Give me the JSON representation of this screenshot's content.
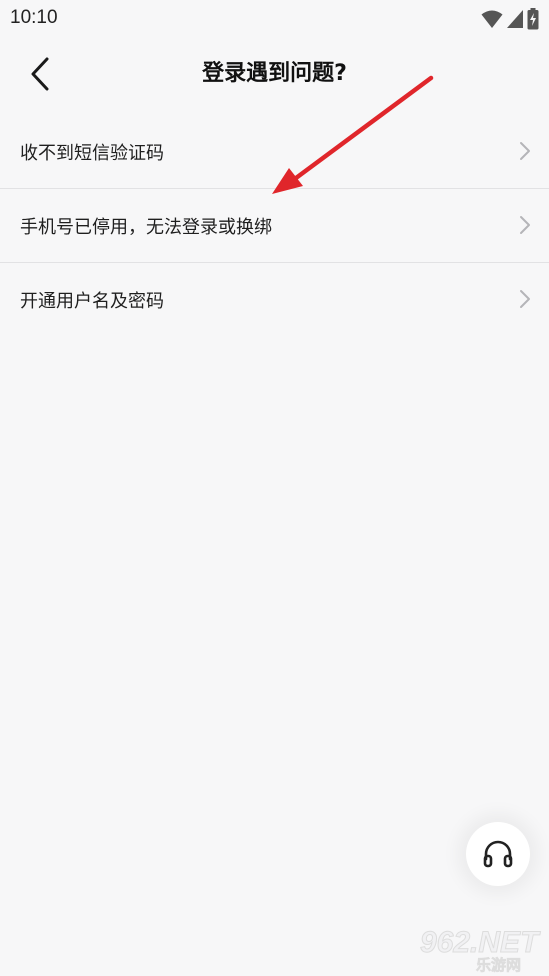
{
  "status_bar": {
    "time": "10:10",
    "icons": [
      "wifi-icon",
      "signal-icon",
      "battery-charging-icon"
    ]
  },
  "nav": {
    "back_icon": "chevron-left-icon",
    "title": "登录遇到问题?"
  },
  "menu": {
    "items": [
      {
        "label": "收不到短信验证码",
        "icon": "chevron-right-icon"
      },
      {
        "label": "手机号已停用，无法登录或换绑",
        "icon": "chevron-right-icon"
      },
      {
        "label": "开通用户名及密码",
        "icon": "chevron-right-icon"
      }
    ]
  },
  "support": {
    "icon": "headset-icon"
  },
  "annotation": {
    "arrow_color": "#e0262b"
  },
  "watermark": {
    "text": "962.NET",
    "subtext": "乐游网"
  },
  "colors": {
    "background": "#f7f7f8",
    "divider": "#e2e2e4",
    "chevron": "#b5b5b8"
  }
}
